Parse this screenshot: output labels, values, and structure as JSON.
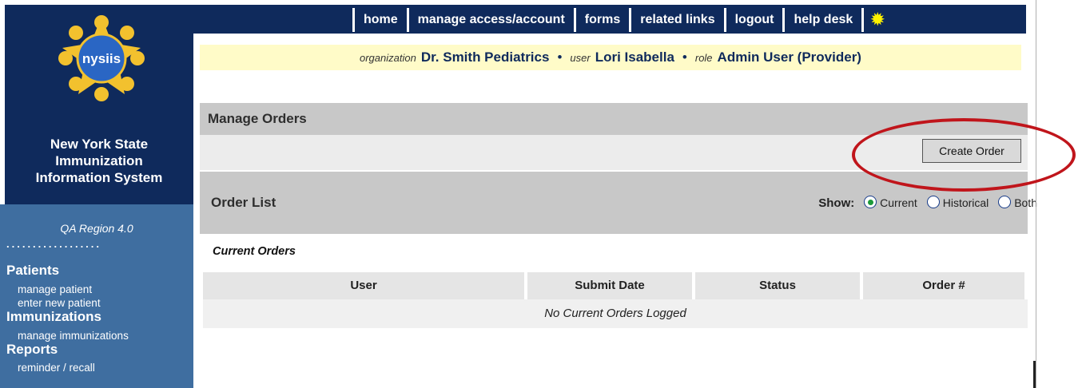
{
  "brand": {
    "logo_text": "nysiis",
    "org_lines": [
      "New York State",
      "Immunization",
      "Information System"
    ]
  },
  "sidebar": {
    "region": "QA Region 4.0",
    "divider": "..................",
    "groups": [
      {
        "title": "Patients",
        "links": [
          "manage patient",
          "enter new patient"
        ]
      },
      {
        "title": "Immunizations",
        "links": [
          "manage immunizations"
        ]
      },
      {
        "title": "Reports",
        "links": [
          "reminder / recall"
        ]
      }
    ]
  },
  "topnav": {
    "items": [
      "home",
      "manage access/account",
      "forms",
      "related links",
      "logout",
      "help desk"
    ],
    "bulb_icon": "lightbulb-icon"
  },
  "info": {
    "organization_label": "organization",
    "organization": "Dr. Smith Pediatrics",
    "user_label": "user",
    "user": "Lori Isabella",
    "role_label": "role",
    "role": "Admin User (Provider)",
    "separator": "•"
  },
  "manage_orders": {
    "title": "Manage Orders",
    "create_button": "Create Order"
  },
  "order_list": {
    "title": "Order List",
    "show_label": "Show:",
    "options": [
      "Current",
      "Historical",
      "Both"
    ],
    "selected": "Current",
    "section_label": "Current Orders",
    "columns": [
      "User",
      "Submit Date",
      "Status",
      "Order #"
    ],
    "empty_message": "No Current Orders Logged"
  },
  "colors": {
    "navy": "#0f2a5c",
    "sidebar_blue": "#3f6ea0",
    "info_yellow": "#fffbc8",
    "header_gray": "#c8c8c8",
    "highlight_red": "#c0151b",
    "radio_green": "#1c9a3a"
  }
}
